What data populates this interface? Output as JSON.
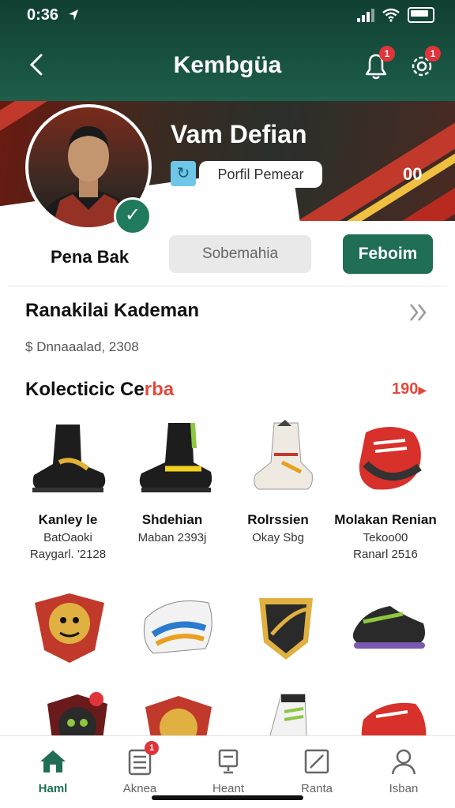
{
  "status": {
    "time": "0:36"
  },
  "header": {
    "title": "Kembgüa",
    "notif_badge": "1",
    "settings_badge": "1"
  },
  "profile": {
    "name": "Vam Defian",
    "pill_label": "Porfil Pemear",
    "hero_number": "00",
    "pena_label": "Pena Bak",
    "gray_button": "Sobemahia",
    "green_button": "Feboim"
  },
  "section1": {
    "title": "Ranakilai Kademan",
    "downloads": "Dnnaaalad, 2308"
  },
  "section2": {
    "title_black": "Kolecticic Ce",
    "title_red": "rba",
    "count": "190"
  },
  "items": [
    {
      "name": "Kanley le",
      "line1": "BatOaoki",
      "line2": "Raygarl. '2128"
    },
    {
      "name": "Shdehian",
      "line1": "Maban 2393j",
      "line2": ""
    },
    {
      "name": "Rolrssien",
      "line1": "Okay Sbg",
      "line2": ""
    },
    {
      "name": "Molakan Renian",
      "line1": "Tekoo00",
      "line2": "Ranarl 2516"
    }
  ],
  "colors": {
    "brand_green": "#1f6e55",
    "header_dark": "#103f32",
    "accent_red": "#e0333a"
  },
  "nav": [
    {
      "label": "Haml",
      "icon": "home-icon"
    },
    {
      "label": "Aknea",
      "icon": "list-icon",
      "badge": "1"
    },
    {
      "label": "Heant",
      "icon": "trophy-icon"
    },
    {
      "label": "Ranta",
      "icon": "edit-icon"
    },
    {
      "label": "Isban",
      "icon": "user-icon"
    }
  ]
}
